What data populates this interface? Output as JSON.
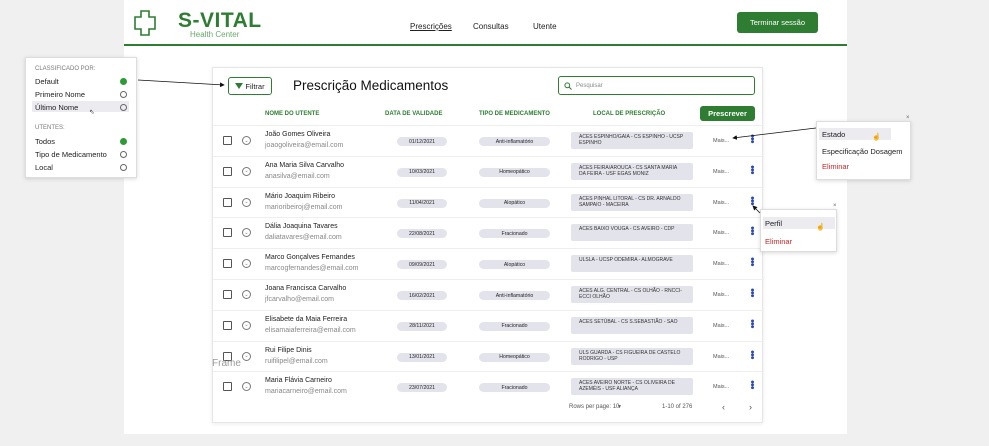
{
  "brand": {
    "name": "S-VITAL",
    "subtitle": "Health Center"
  },
  "nav": {
    "prescricoes": "Prescrições",
    "consultas": "Consultas",
    "utente": "Utente"
  },
  "header": {
    "end_session": "Terminar sessão"
  },
  "toolbar": {
    "filter_label": "Filtrar",
    "title": "Prescrição Medicamentos",
    "search_placeholder": "Pesquisar",
    "prescribe_label": "Prescrever"
  },
  "columns": {
    "name": "NOME DO UTENTE",
    "date": "DATA DE VALIDADE",
    "type": "TIPO DE MEDICAMENTO",
    "location": "LOCAL DE PRESCRIÇÃO"
  },
  "rows": [
    {
      "name": "João Gomes Oliveira",
      "email": "joaogoliveira@email.com",
      "date": "01/12/2021",
      "type": "Anti-inflamatório",
      "location": "ACES ESPINHO/GAIA - CS ESPINHO - UCSP ESPINHO",
      "more": "Mais..."
    },
    {
      "name": "Ana Maria Silva Carvalho",
      "email": "anasilva@email.com",
      "date": "10/03/2021",
      "type": "Homeopático",
      "location": "ACES FEIRA/AROUCA - CS SANTA MARIA DA FEIRA - USF EGAS MONIZ",
      "more": "Mais..."
    },
    {
      "name": "Mário Joaquim Ribeiro",
      "email": "marioribeiroj@email.com",
      "date": "11/04/2021",
      "type": "Alopático",
      "location": "ACES PINHAL LITORAL - CS DR. ARNALDO SAMPAIO - MACEIRA",
      "more": "Mais..."
    },
    {
      "name": "Dália Joaquina Tavares",
      "email": "daliatavares@email.com",
      "date": "22/08/2021",
      "type": "Fracionado",
      "location": "ACES BAIXO VOUGA - CS AVEIRO - CDP",
      "more": "Mais..."
    },
    {
      "name": "Marco Gonçalves Fernandes",
      "email": "marcogfernandes@email.com",
      "date": "09/09/2021",
      "type": "Alopático",
      "location": "ULSLA - UCSP ODEMIRA - ALMOGRAVE",
      "more": "Mais..."
    },
    {
      "name": "Joana Francisca Carvalho",
      "email": "jfcarvalho@email.com",
      "date": "16/02/2021",
      "type": "Anti-inflamatório",
      "location": "ACES ALG. CENTRAL - CS OLHÃO - RNCCI-ECCI OLHÃO",
      "more": "Mais..."
    },
    {
      "name": "Elisabete da Maia Ferreira",
      "email": "elisamaiaferreira@email.com",
      "date": "28/11/2021",
      "type": "Fracionado",
      "location": "ACES SETÚBAL - CS S.SEBASTIÃO - SAO",
      "more": "Mais..."
    },
    {
      "name": "Rui Filipe Dinis",
      "email": "ruifilipel@email.com",
      "date": "13/01/2021",
      "type": "Homeopático",
      "location": "ULS GUARDA - CS FIGUEIRA DE CASTELO RODRIGO - USP",
      "more": "Mais..."
    },
    {
      "name": "Maria Flávia Carneiro",
      "email": "mariacarneiro@email.com",
      "date": "23/07/2021",
      "type": "Fracionado",
      "location": "ACES AVEIRO NORTE - CS OLIVEIRA DE AZEMÉIS - USF ALIANÇA",
      "more": "Mais..."
    }
  ],
  "footer": {
    "rows_per_page": "Rows per page: 10",
    "range": "1-10 of 276",
    "prev": "‹",
    "next": "›"
  },
  "left_panel": {
    "sort_header": "CLASSIFICADO POR:",
    "sort_options": [
      "Default",
      "Primeiro Nome",
      "Último Nome"
    ],
    "sort_selected": "Default",
    "users_header": "UTENTES:",
    "user_options": [
      "Todos",
      "Tipo de Medicamento",
      "Local"
    ],
    "user_selected": "Todos"
  },
  "estado_menu": {
    "items": [
      "Estado",
      "Especificação Dosagem"
    ],
    "danger": "Eliminar",
    "close": "×"
  },
  "perfil_menu": {
    "items": [
      "Perfil"
    ],
    "danger": "Eliminar",
    "close": "×"
  },
  "frame_label": "Frame",
  "colors": {
    "primary": "#2e7d32",
    "danger": "#c62828",
    "pill": "#e3e3ec"
  }
}
